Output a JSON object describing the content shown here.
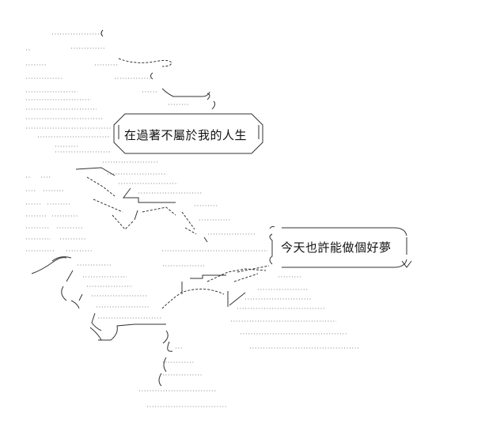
{
  "art": {
    "speech_1": "在過著不屬於我的人生",
    "speech_2": "今天也許能做個好夢"
  }
}
